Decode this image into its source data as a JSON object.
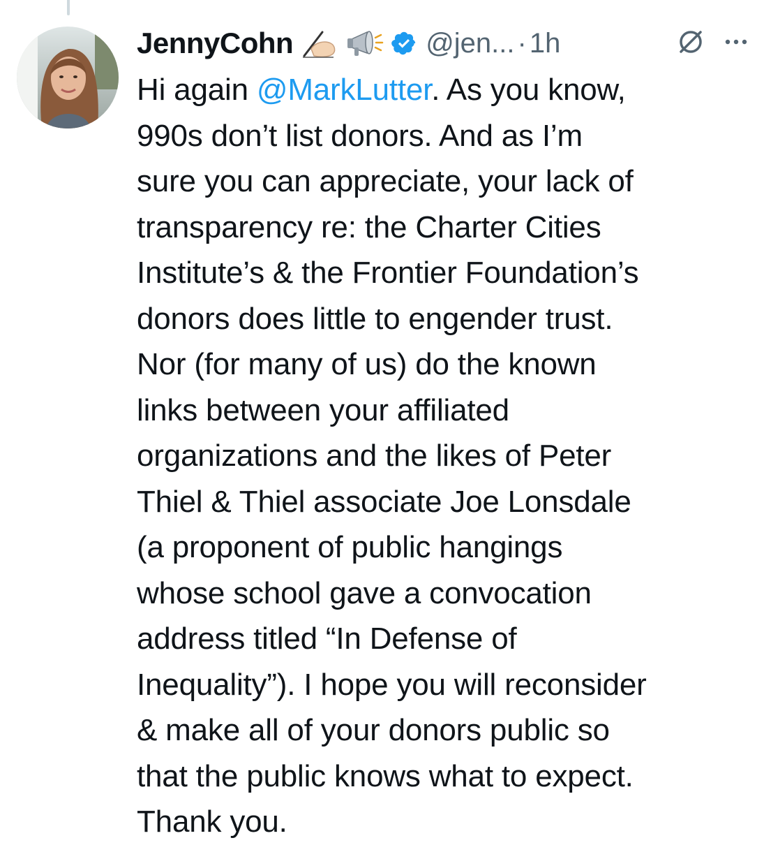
{
  "tweet": {
    "author": {
      "display_name": "JennyCohn",
      "handle": "@jen...",
      "verified": true
    },
    "separator": "·",
    "time": "1h",
    "body_lines": [
      {
        "before": "Hi again ",
        "mention": "@MarkLutter",
        "after": ". As you know,"
      },
      {
        "text": "990s don’t list donors. And as I’m"
      },
      {
        "text": "sure you can appreciate, your lack of"
      },
      {
        "text": "transparency re: the Charter Cities"
      },
      {
        "text": "Institute’s & the Frontier Foundation’s"
      },
      {
        "text": "donors does little to engender trust."
      },
      {
        "text": "Nor (for many of us) do the known"
      },
      {
        "text": "links between your affiliated"
      },
      {
        "text": "organizations and the likes of Peter"
      },
      {
        "text": "Thiel & Thiel associate Joe Lonsdale"
      },
      {
        "text": "(a proponent of public hangings"
      },
      {
        "text": "whose school gave a convocation"
      },
      {
        "text": "address titled “In Defense of"
      },
      {
        "text": "Inequality”). I hope you will reconsider"
      },
      {
        "text": "& make all of your donors public so"
      },
      {
        "text": "that the public knows what to expect."
      },
      {
        "text": "Thank you."
      }
    ]
  },
  "icons": {
    "name_emojis": [
      "writing-hand-icon",
      "megaphone-icon"
    ],
    "verified": "verified-badge-icon",
    "header_actions": [
      "grok-icon",
      "more-options-icon"
    ]
  },
  "colors": {
    "text": "#0f1419",
    "secondary": "#536471",
    "link": "#1d9bf0",
    "verified": "#1d9bf0"
  }
}
